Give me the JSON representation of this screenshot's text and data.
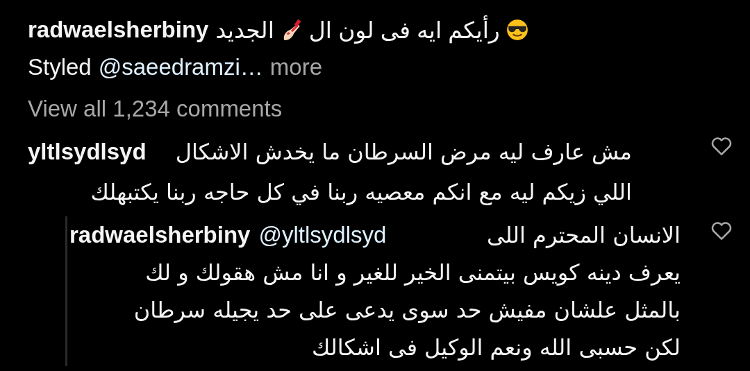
{
  "caption": {
    "username": "radwaelsherbiny",
    "text_start": "رأيكم ايه فى لون ال",
    "text_end": "الجديد",
    "styled_prefix": "Styled",
    "mention": "@saeedramzi…",
    "more": "more"
  },
  "view_all": "View all 1,234 comments",
  "comments": [
    {
      "kind": "comment",
      "username": "yltlsydlsyd",
      "lines": [
        "مش عارف ليه مرض السرطان ما يخدش الاشكال",
        "اللي زيكم ليه مع انكم معصيه ربنا في كل حاجه ربنا يكتبهلك"
      ],
      "liked": false
    },
    {
      "kind": "reply",
      "username": "radwaelsherbiny",
      "mention": "@yltlsydlsyd",
      "lines": [
        "الانسان المحترم اللى",
        "يعرف دينه كويس بيتمنى الخير للغير و انا مش هقولك و لك",
        "بالمثل علشان مفيش حد سوى يدعى على حد يجيله سرطان",
        "لكن حسبى الله ونعم الوكيل فى اشكالك"
      ],
      "liked": false
    }
  ]
}
